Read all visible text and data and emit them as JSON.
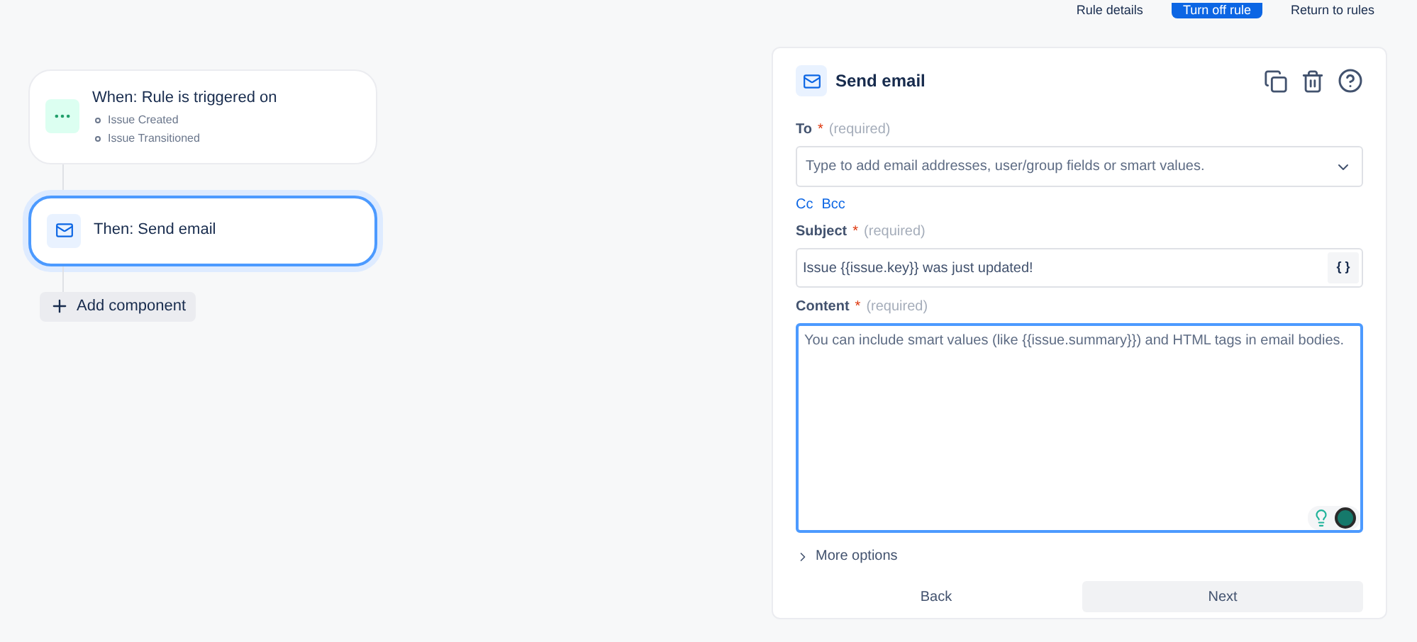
{
  "header_buttons": [
    {
      "label": "Rule details",
      "kind": "subtle"
    },
    {
      "label": "Turn off rule",
      "kind": "primary"
    },
    {
      "label": "Return to rules",
      "kind": "subtle"
    }
  ],
  "flow": {
    "nodes": [
      {
        "kind": "trigger",
        "title": "When: Rule is triggered on",
        "items": [
          "Issue Created",
          "Issue Transitioned"
        ],
        "selected": false
      },
      {
        "kind": "action",
        "title": "Then: Send email",
        "selected": true
      }
    ],
    "add_button": "Add component"
  },
  "panel": {
    "title": "Send email",
    "to": {
      "label": "To",
      "required_mark": "*",
      "required_note": "(required)",
      "placeholder": "Type to add email addresses, user/group fields or smart values."
    },
    "links": [
      "Cc",
      "Bcc"
    ],
    "subject": {
      "label": "Subject",
      "required_mark": "*",
      "required_note": "(required)",
      "value": "Issue {{issue.key}} was just updated!",
      "button": "{ }"
    },
    "content": {
      "label": "Content",
      "required_mark": "*",
      "required_note": "(required)",
      "placeholder": "You can include smart values (like {{issue.summary}}) and HTML tags in email bodies."
    },
    "more_options": {
      "label": "More options",
      "expanded": false
    },
    "buttons": [
      "Back",
      "Next"
    ]
  }
}
